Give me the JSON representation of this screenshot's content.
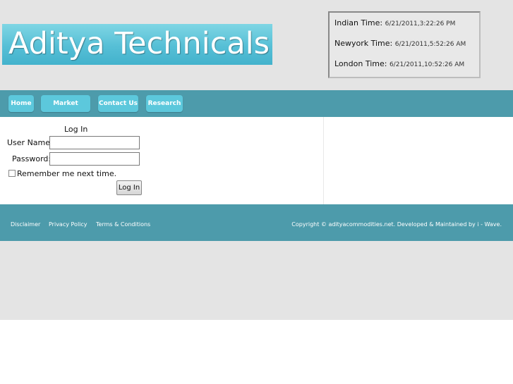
{
  "header": {
    "logo_text": "Aditya Technicals",
    "times": [
      {
        "label": "Indian Time:",
        "value": "6/21/2011,3:22:26 PM"
      },
      {
        "label": "Newyork Time:",
        "value": "6/21/2011,5:52:26 AM"
      },
      {
        "label": "London Time:",
        "value": "6/21/2011,10:52:26 AM"
      }
    ]
  },
  "nav": {
    "items": [
      {
        "label": "Home"
      },
      {
        "label": "Market Watch"
      },
      {
        "label": "Contact Us"
      },
      {
        "label": "Research"
      }
    ]
  },
  "login": {
    "title": "Log In",
    "username_label": "User Name:",
    "username_value": "",
    "password_label": "Password:",
    "password_value": "",
    "remember_label": "Remember me next time.",
    "remember_checked": false,
    "button_label": "Log In"
  },
  "footer": {
    "links": [
      {
        "label": "Disclaimer"
      },
      {
        "label": "Privacy Policy"
      },
      {
        "label": "Terms & Conditions"
      }
    ],
    "copyright": "Copyright © adityacommodities.net.  Developed & Maintained by i - Wave."
  },
  "colors": {
    "nav_bar": "#4d9bab",
    "nav_button": "#5cc8dc",
    "background_gray": "#e4e4e4"
  }
}
